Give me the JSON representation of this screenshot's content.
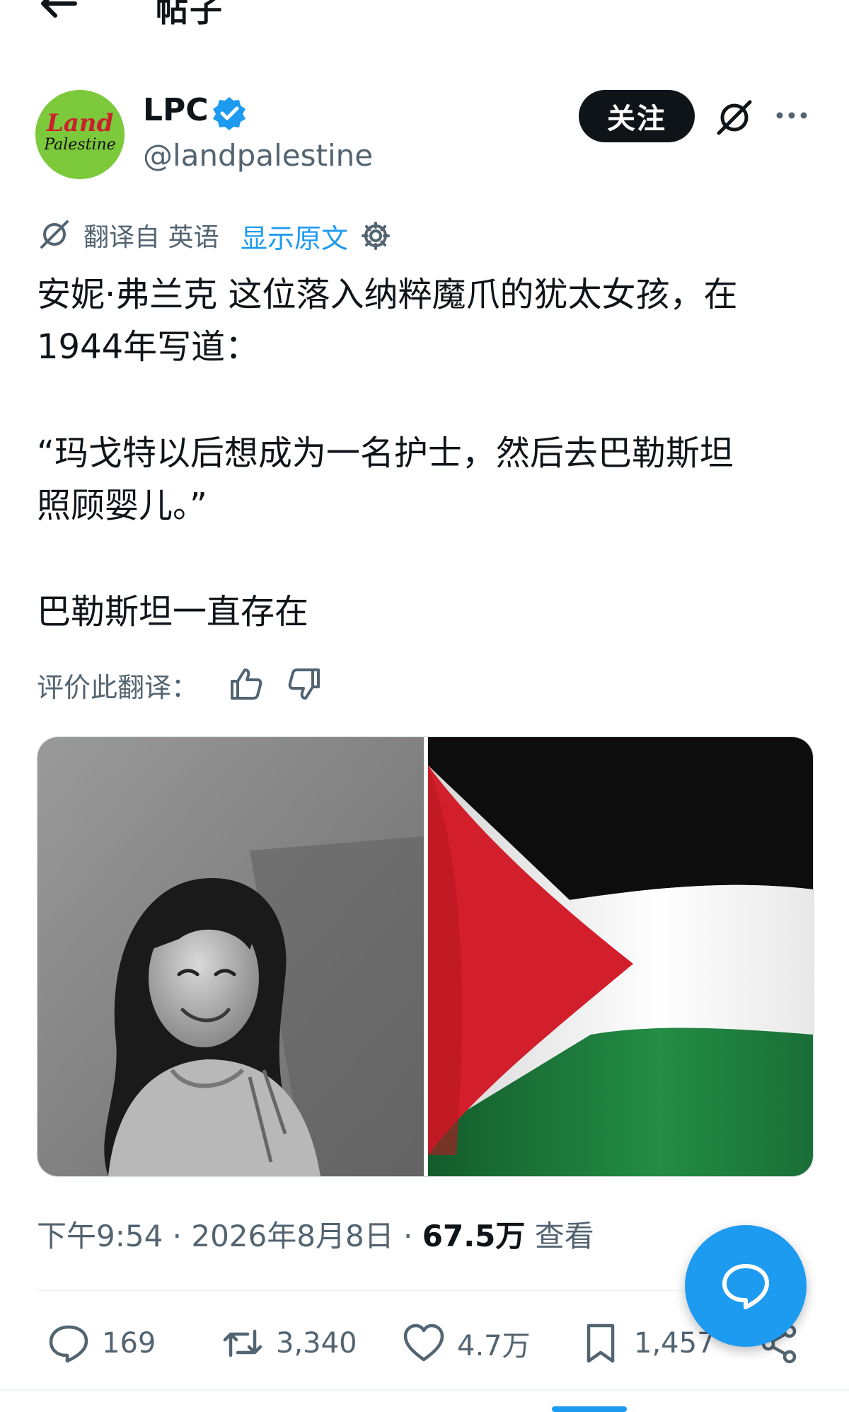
{
  "header": {
    "title": "帖子"
  },
  "author": {
    "name": "LPC",
    "handle": "@landpalestine",
    "avatar_text_1": "Land",
    "avatar_text_2": "Palestine",
    "follow_label": "关注"
  },
  "translation": {
    "label": "翻译自 英语",
    "show_original": "显示原文",
    "rate_label": "评价此翻译："
  },
  "post": {
    "lines": [
      "安妮·弗兰克 这位落入纳粹魔爪的犹太女孩，在",
      "1944年写道：",
      "“玛戈特以后想成为一名护士，然后去巴勒斯坦",
      "照顾婴儿。”",
      "巴勒斯坦一直存在"
    ],
    "time": "下午9:54 · 2026年8月8日 · ",
    "views_count": "67.5万",
    "views_label": " 查看"
  },
  "actions": {
    "replies": "169",
    "reposts": "3,340",
    "likes": "4.7万",
    "bookmarks": "1,457"
  },
  "icons": [
    "back-arrow-icon",
    "verified-icon",
    "grok-icon",
    "more-icon",
    "translate-icon",
    "settings-icon",
    "thumbs-up-icon",
    "thumbs-down-icon",
    "reply-icon",
    "repost-icon",
    "like-icon",
    "bookmark-icon",
    "share-icon",
    "compose-icon"
  ],
  "colors": {
    "accent": "#1d9bf0",
    "text": "#0f1419",
    "muted": "#536471",
    "avatar_bg": "#7cc93b",
    "flag_red": "#d21f2b",
    "flag_green": "#1f7a3c"
  }
}
